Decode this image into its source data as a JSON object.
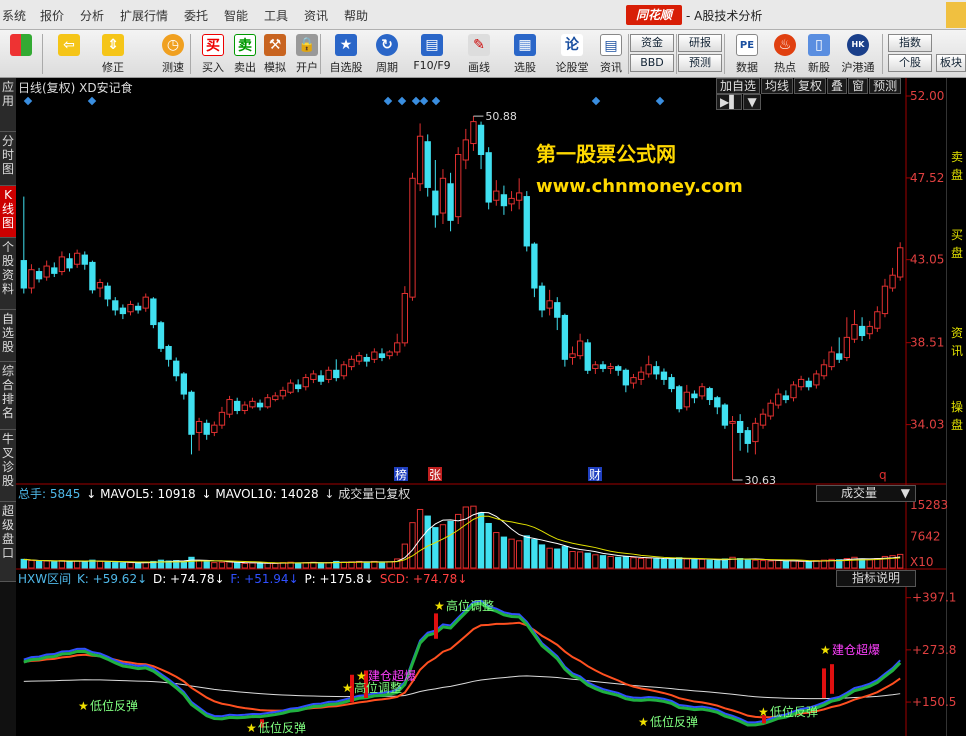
{
  "menu": [
    "系统",
    "报价",
    "分析",
    "扩展行情",
    "委托",
    "智能",
    "工具",
    "资讯",
    "帮助"
  ],
  "app": {
    "logo": "同花顺",
    "title": "- A股技术分析"
  },
  "toolbar": {
    "buttons": [
      {
        "label": "",
        "icon": "windows-icon"
      },
      {
        "label": "",
        "icon": "back-arrow-icon"
      },
      {
        "label": "修正",
        "icon": "up-down-arrow-icon"
      },
      {
        "label": "测速",
        "icon": "clock-icon"
      },
      {
        "label": "买入",
        "icon": "buy-icon",
        "glyph": "买"
      },
      {
        "label": "卖出",
        "icon": "sell-icon",
        "glyph": "卖"
      },
      {
        "label": "模拟",
        "icon": "hammer-icon"
      },
      {
        "label": "开户",
        "icon": "lock-icon"
      },
      {
        "label": "自选股",
        "icon": "star-icon"
      },
      {
        "label": "周期",
        "icon": "cycle-icon"
      },
      {
        "label": "F10/F9",
        "icon": "f10-icon"
      },
      {
        "label": "画线",
        "icon": "pen-icon"
      },
      {
        "label": "选股",
        "icon": "chart-pick-icon"
      },
      {
        "label": "论股堂",
        "icon": "forum-icon",
        "glyph": "论"
      },
      {
        "label": "资讯",
        "icon": "news-icon"
      },
      {
        "label": "数据",
        "icon": "pe-icon",
        "glyph": "PE"
      },
      {
        "label": "热点",
        "icon": "fire-icon"
      },
      {
        "label": "新股",
        "icon": "ipo-icon"
      },
      {
        "label": "沪港通",
        "icon": "sse-hk-icon"
      }
    ],
    "small_buttons": [
      "资金",
      "BBD",
      "研报",
      "预测",
      "指数",
      "个股",
      "板块"
    ]
  },
  "side_tabs": [
    "应用",
    "分时图",
    "K线图",
    "个股资料",
    "自选股",
    "综合排名",
    "牛叉诊股",
    "超级盘口"
  ],
  "chart": {
    "title": "日线(复权)  XD安记食",
    "header_buttons": [
      "加自选",
      "均线",
      "复权",
      "叠",
      "窗",
      "预测",
      "▶▌",
      "▼"
    ],
    "watermark_line1": "第一股票公式网",
    "watermark_line2": "www.chnmoney.com",
    "high_label": "50.88",
    "low_label": "30.63",
    "markers": [
      "榜",
      "张",
      "财",
      "q"
    ]
  },
  "right_strip": [
    "卖",
    "盘",
    "买",
    "盘",
    "资",
    "讯",
    "操",
    "盘"
  ],
  "volume": {
    "header": [
      {
        "text": "总手: 5845",
        "color": "#4fb8e8"
      },
      {
        "text": "↓ MAVOL5: 10918",
        "color": "#ffffff"
      },
      {
        "text": "↓ MAVOL10: 14028",
        "color": "#ffffff"
      },
      {
        "text": "↓ 成交量已复权",
        "color": "#dddddd"
      }
    ],
    "select": "成交量",
    "axis": [
      "15283",
      "7642",
      "X10"
    ]
  },
  "indicator": {
    "header": [
      {
        "text": "HXW区间",
        "color": "#4fb8e8"
      },
      {
        "text": "K: +59.62↓",
        "color": "#4fb8e8"
      },
      {
        "text": "D: +74.78↓",
        "color": "#ffffff"
      },
      {
        "text": "F: +51.94↓",
        "color": "#3050ff"
      },
      {
        "text": "P: +175.8↓",
        "color": "#ffffff"
      },
      {
        "text": "SCD: +74.78↓",
        "color": "#ff4040"
      }
    ],
    "help": "指标说明",
    "axis": [
      "397.1",
      "273.8",
      "150.5"
    ],
    "signals": [
      {
        "text": "低位反弹",
        "color": "#80ff80"
      },
      {
        "text": "低位反弹",
        "color": "#80ff80"
      },
      {
        "text": "高位调整",
        "color": "#80ff80"
      },
      {
        "text": "建仓超爆",
        "color": "#ff40ff"
      },
      {
        "text": "高位调整",
        "color": "#80ff80"
      },
      {
        "text": "低位反弹",
        "color": "#80ff80"
      },
      {
        "text": "低位反弹",
        "color": "#80ff80"
      },
      {
        "text": "建仓超爆",
        "color": "#ff40ff"
      }
    ]
  },
  "chart_data": {
    "type": "candlestick",
    "price_axis": [
      52.0,
      47.52,
      43.05,
      38.51,
      34.03
    ],
    "ylim": [
      31.0,
      52.0
    ],
    "candles": [
      [
        43.0,
        41.5,
        46.5,
        41.2
      ],
      [
        41.5,
        42.5,
        42.8,
        41.2
      ],
      [
        42.4,
        42.0,
        42.6,
        41.8
      ],
      [
        42.1,
        42.7,
        43.0,
        41.9
      ],
      [
        42.6,
        42.3,
        42.9,
        42.1
      ],
      [
        42.4,
        43.2,
        43.5,
        42.2
      ],
      [
        43.1,
        42.6,
        43.4,
        42.4
      ],
      [
        42.8,
        43.4,
        43.6,
        42.6
      ],
      [
        43.3,
        42.8,
        43.5,
        42.5
      ],
      [
        42.9,
        41.4,
        43.0,
        41.2
      ],
      [
        41.5,
        41.8,
        42.0,
        41.0
      ],
      [
        41.6,
        40.9,
        41.8,
        40.5
      ],
      [
        40.8,
        40.3,
        41.0,
        40.0
      ],
      [
        40.4,
        40.1,
        40.6,
        39.8
      ],
      [
        40.2,
        40.6,
        40.8,
        40.0
      ],
      [
        40.5,
        40.3,
        40.7,
        40.1
      ],
      [
        40.4,
        41.0,
        41.2,
        40.2
      ],
      [
        40.9,
        39.5,
        41.0,
        39.3
      ],
      [
        39.6,
        38.2,
        39.7,
        38.0
      ],
      [
        38.3,
        37.6,
        38.4,
        37.2
      ],
      [
        37.5,
        36.7,
        37.7,
        36.4
      ],
      [
        36.8,
        35.7,
        36.9,
        35.4
      ],
      [
        35.8,
        33.5,
        35.9,
        32.4
      ],
      [
        33.6,
        34.2,
        34.4,
        32.6
      ],
      [
        34.1,
        33.5,
        34.3,
        33.2
      ],
      [
        33.6,
        34.0,
        34.2,
        33.4
      ],
      [
        34.0,
        34.7,
        35.0,
        33.8
      ],
      [
        34.6,
        35.4,
        35.6,
        34.4
      ],
      [
        35.3,
        34.8,
        35.5,
        34.6
      ],
      [
        34.8,
        35.1,
        35.3,
        34.6
      ],
      [
        35.0,
        35.3,
        35.5,
        34.9
      ],
      [
        35.2,
        35.0,
        35.4,
        34.8
      ],
      [
        35.0,
        35.5,
        35.7,
        34.9
      ],
      [
        35.4,
        35.6,
        35.8,
        35.3
      ],
      [
        35.6,
        35.9,
        36.1,
        35.4
      ],
      [
        35.8,
        36.3,
        36.5,
        35.7
      ],
      [
        36.2,
        36.0,
        36.5,
        35.8
      ],
      [
        36.1,
        36.6,
        36.8,
        35.9
      ],
      [
        36.5,
        36.8,
        37.0,
        36.3
      ],
      [
        36.7,
        36.4,
        37.0,
        36.2
      ],
      [
        36.5,
        37.0,
        37.2,
        36.3
      ],
      [
        37.0,
        36.6,
        37.6,
        36.4
      ],
      [
        36.7,
        37.3,
        37.5,
        36.5
      ],
      [
        37.2,
        37.6,
        37.8,
        37.0
      ],
      [
        37.5,
        37.8,
        38.0,
        37.3
      ],
      [
        37.7,
        37.5,
        37.9,
        37.2
      ],
      [
        37.6,
        38.0,
        38.2,
        37.4
      ],
      [
        37.9,
        37.7,
        38.2,
        37.5
      ],
      [
        37.8,
        38.0,
        38.1,
        37.6
      ],
      [
        38.0,
        38.5,
        39.0,
        37.8
      ],
      [
        38.5,
        41.2,
        41.6,
        38.3
      ],
      [
        41.0,
        47.5,
        47.8,
        40.8
      ],
      [
        47.2,
        49.8,
        50.5,
        46.8
      ],
      [
        49.5,
        47.0,
        49.9,
        46.5
      ],
      [
        46.8,
        45.5,
        48.5,
        44.8
      ],
      [
        45.6,
        47.5,
        48.0,
        45.0
      ],
      [
        47.2,
        45.2,
        47.8,
        44.6
      ],
      [
        45.4,
        48.8,
        49.2,
        45.0
      ],
      [
        48.5,
        49.6,
        50.2,
        48.0
      ],
      [
        49.4,
        50.6,
        50.9,
        49.0
      ],
      [
        50.4,
        48.8,
        50.6,
        48.0
      ],
      [
        48.9,
        46.2,
        49.2,
        45.8
      ],
      [
        46.3,
        46.8,
        47.4,
        46.0
      ],
      [
        46.6,
        46.0,
        47.1,
        45.5
      ],
      [
        46.1,
        46.4,
        46.8,
        45.7
      ],
      [
        46.3,
        46.7,
        47.5,
        45.8
      ],
      [
        46.5,
        43.8,
        46.8,
        43.5
      ],
      [
        43.9,
        41.5,
        44.0,
        41.0
      ],
      [
        41.6,
        40.3,
        41.8,
        39.9
      ],
      [
        40.4,
        40.8,
        41.4,
        40.0
      ],
      [
        40.7,
        39.9,
        41.0,
        39.2
      ],
      [
        40.0,
        37.6,
        40.1,
        37.2
      ],
      [
        37.7,
        37.9,
        38.3,
        37.3
      ],
      [
        37.8,
        38.6,
        39.0,
        37.6
      ],
      [
        38.5,
        37.0,
        38.7,
        36.8
      ],
      [
        37.1,
        37.3,
        37.5,
        36.8
      ],
      [
        37.3,
        37.1,
        37.5,
        36.9
      ],
      [
        37.1,
        37.2,
        37.4,
        36.8
      ],
      [
        37.2,
        37.0,
        37.3,
        36.7
      ],
      [
        37.0,
        36.2,
        37.1,
        35.8
      ],
      [
        36.3,
        36.6,
        36.8,
        36.0
      ],
      [
        36.5,
        36.9,
        37.2,
        36.2
      ],
      [
        36.8,
        37.3,
        37.8,
        36.6
      ],
      [
        37.2,
        36.8,
        37.5,
        36.5
      ],
      [
        36.9,
        36.5,
        37.1,
        36.2
      ],
      [
        36.6,
        36.0,
        36.8,
        35.8
      ],
      [
        36.1,
        34.9,
        36.2,
        34.7
      ],
      [
        35.0,
        35.8,
        36.2,
        34.8
      ],
      [
        35.7,
        35.5,
        35.9,
        35.2
      ],
      [
        35.6,
        36.1,
        36.3,
        35.4
      ],
      [
        36.0,
        35.4,
        36.1,
        35.1
      ],
      [
        35.5,
        35.0,
        35.6,
        34.6
      ],
      [
        35.1,
        34.0,
        35.2,
        33.8
      ],
      [
        34.1,
        34.2,
        34.5,
        31.0
      ],
      [
        34.2,
        33.6,
        34.6,
        32.6
      ],
      [
        33.7,
        33.0,
        33.9,
        32.5
      ],
      [
        33.1,
        34.1,
        34.4,
        32.4
      ],
      [
        34.0,
        34.6,
        34.9,
        33.8
      ],
      [
        34.5,
        35.2,
        35.4,
        34.3
      ],
      [
        35.1,
        35.7,
        36.0,
        34.9
      ],
      [
        35.6,
        35.4,
        35.9,
        35.2
      ],
      [
        35.5,
        36.2,
        36.4,
        35.3
      ],
      [
        36.1,
        36.5,
        36.7,
        35.9
      ],
      [
        36.4,
        36.1,
        36.6,
        35.9
      ],
      [
        36.2,
        36.8,
        37.0,
        36.0
      ],
      [
        36.7,
        37.3,
        37.6,
        36.5
      ],
      [
        37.2,
        38.0,
        38.3,
        37.0
      ],
      [
        37.9,
        37.6,
        38.8,
        37.4
      ],
      [
        37.7,
        38.8,
        39.9,
        37.5
      ],
      [
        38.7,
        39.5,
        40.3,
        38.5
      ],
      [
        39.4,
        38.9,
        39.9,
        38.6
      ],
      [
        39.0,
        39.4,
        39.7,
        38.7
      ],
      [
        39.3,
        40.2,
        40.5,
        39.1
      ],
      [
        40.1,
        41.6,
        42.0,
        39.9
      ],
      [
        41.5,
        42.2,
        42.6,
        41.3
      ],
      [
        42.1,
        43.7,
        44.0,
        41.9
      ]
    ],
    "volume_axis": [
      15283,
      7642
    ],
    "volume": [
      2.1,
      1.8,
      1.6,
      1.7,
      1.5,
      1.8,
      1.6,
      1.7,
      1.5,
      1.9,
      1.6,
      1.4,
      1.3,
      1.2,
      1.3,
      1.2,
      1.4,
      1.6,
      1.9,
      1.7,
      1.8,
      1.6,
      2.6,
      1.8,
      1.5,
      1.3,
      1.4,
      1.5,
      1.2,
      1.1,
      1.2,
      1.1,
      1.2,
      1.1,
      1.3,
      1.4,
      1.2,
      1.3,
      1.4,
      1.2,
      1.3,
      1.6,
      1.4,
      1.5,
      1.6,
      1.4,
      1.6,
      1.4,
      1.5,
      2.2,
      5.8,
      11.0,
      14.2,
      12.6,
      9.8,
      10.5,
      11.3,
      13.0,
      14.8,
      15.0,
      13.4,
      10.8,
      8.6,
      7.5,
      7.0,
      6.6,
      7.8,
      6.9,
      5.6,
      4.8,
      4.6,
      5.2,
      4.0,
      3.9,
      3.6,
      3.2,
      3.0,
      2.8,
      2.6,
      2.7,
      2.5,
      2.3,
      2.4,
      2.2,
      2.1,
      2.3,
      2.5,
      2.2,
      2.0,
      2.1,
      1.9,
      1.8,
      2.2,
      2.6,
      2.3,
      2.0,
      1.9,
      1.8,
      1.7,
      1.8,
      1.6,
      1.7,
      1.6,
      1.5,
      1.8,
      1.9,
      2.1,
      2.0,
      2.3,
      2.6,
      2.2,
      2.0,
      2.3,
      2.8,
      3.0,
      3.3
    ],
    "indicator_axis": [
      397.1,
      273.8,
      150.5
    ],
    "indicator_ylim": [
      75,
      420
    ]
  }
}
